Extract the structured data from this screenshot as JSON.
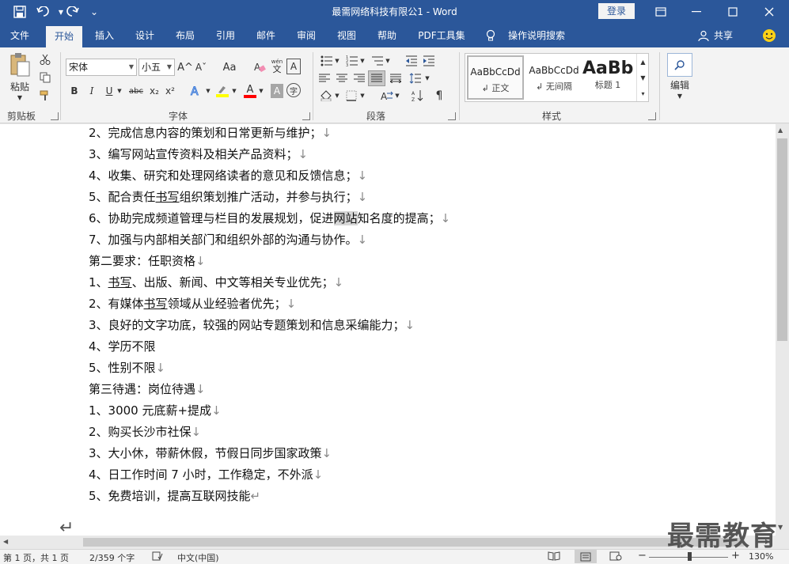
{
  "titlebar": {
    "title": "最需网络科技有限公1 - Word",
    "login_label": "登录",
    "customize_glyph": "⌄"
  },
  "tabs": [
    "文件",
    "开始",
    "插入",
    "设计",
    "布局",
    "引用",
    "邮件",
    "审阅",
    "视图",
    "帮助",
    "PDF工具集",
    "操作说明搜索"
  ],
  "share_label": "共享",
  "ribbon": {
    "clipboard": {
      "label": "剪贴板",
      "paste_label": "粘贴"
    },
    "font": {
      "label": "字体",
      "font_name": "宋体",
      "font_size": "小五",
      "wen_glyph": "wén",
      "wen_char": "文",
      "a_glyph": "A",
      "char_shade": "A",
      "enclose_char": "字",
      "bold": "B",
      "italic": "I",
      "underline": "U",
      "strike": "abc",
      "sub": "x₂",
      "sup": "x²",
      "grow": "A^",
      "shrink": "Aˇ",
      "case": "Aa"
    },
    "paragraph": {
      "label": "段落"
    },
    "styles": {
      "label": "样式",
      "items": [
        {
          "sample": "AaBbCcDd",
          "name": "↲ 正文"
        },
        {
          "sample": "AaBbCcDd",
          "name": "↲ 无间隔"
        },
        {
          "sample": "AaBb",
          "name": "标题 1"
        }
      ]
    },
    "editing": {
      "label": "编辑"
    }
  },
  "document": {
    "lines": [
      {
        "pre": "2、完成信息内容的策划和日常更新与维护；",
        "mark": "↓"
      },
      {
        "pre": "3、编写网站宣传资料及相关产品资料；",
        "mark": "↓"
      },
      {
        "pre": "4、收集、研究和处理网络读者的意见和反馈信息；",
        "mark": "↓"
      },
      {
        "pre": "5、配合责任",
        "u": "书写",
        "post": "组织策划推广活动，并参与执行；",
        "mark": "↓"
      },
      {
        "pre": "6、协助完成频道管理与栏目的发展规划，促进",
        "hl": "网站",
        "post": "知名度的提高；",
        "mark": "↓"
      },
      {
        "pre": "7、加强与内部相关部门和组织外部的沟通与协作。",
        "mark": "↓"
      },
      {
        "pre": "第二要求：任职资格",
        "mark": "↓"
      },
      {
        "pre": "1、",
        "u": "书写",
        "post": "、出版、新闻、中文等相关专业优先；",
        "mark": "↓"
      },
      {
        "pre": "2、有媒体",
        "u": "书写",
        "post": "领域从业经验者优先；",
        "mark": "↓"
      },
      {
        "pre": "3、良好的文字功底，较强的网站专题策划和信息采编能力；",
        "mark": "↓"
      },
      {
        "pre": "4、学历不限",
        "mark": ""
      },
      {
        "pre": "5、性别不限",
        "mark": "↓"
      },
      {
        "pre": "第三待遇：岗位待遇",
        "mark": "↓"
      },
      {
        "pre": "1、3000 元底薪+提成",
        "mark": "↓"
      },
      {
        "pre": "2、购买长沙市社保",
        "mark": "↓"
      },
      {
        "pre": "3、大小休，带薪休假，节假日同步国家政策",
        "mark": "↓"
      },
      {
        "pre": "4、日工作时间 7 小时，工作稳定，不外派",
        "mark": "↓"
      },
      {
        "pre": "5、免费培训，提高互联网技能",
        "mark": "↵"
      }
    ],
    "end_mark": "↵"
  },
  "status": {
    "page": "第 1 页，共 1 页",
    "words": "2/359 个字",
    "language": "中文(中国)",
    "zoom_minus": "−",
    "zoom_plus": "+",
    "zoom": "130%"
  },
  "watermark": "最需教育",
  "colors": {
    "brand": "#2b579a",
    "ribbon": "#f3f3f3",
    "highlight_bar": "#ffff00",
    "font_color_bar": "#ff0000"
  }
}
